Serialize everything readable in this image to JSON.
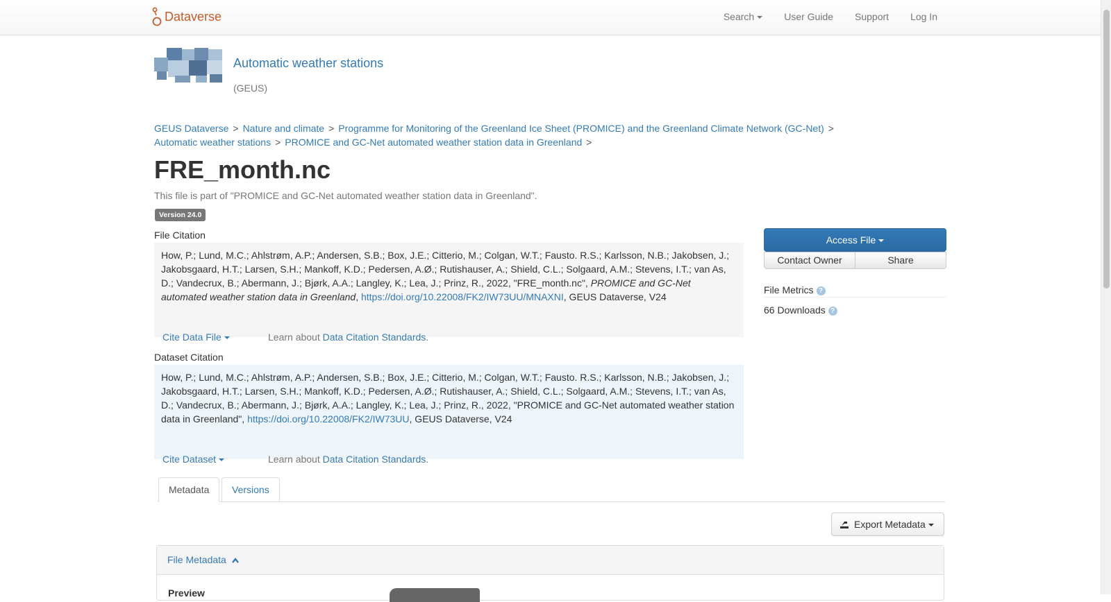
{
  "navbar": {
    "brand": "Dataverse",
    "items": [
      "Search",
      "User Guide",
      "Support",
      "Log In"
    ]
  },
  "dataverse": {
    "title": "Automatic weather stations",
    "affiliation": "(GEUS)"
  },
  "breadcrumb": [
    "GEUS Dataverse",
    "Nature and climate",
    "Programme for Monitoring of the Greenland Ice Sheet (PROMICE) and the Greenland Climate Network (GC-Net)",
    "Automatic weather stations",
    "PROMICE and GC-Net automated weather station data in Greenland"
  ],
  "file": {
    "title": "FRE_month.nc",
    "part_of": "This file is part of \"PROMICE and GC-Net automated weather station data in Greenland\".",
    "version": "Version 24.0"
  },
  "file_citation": {
    "label": "File Citation",
    "authors": "How, P.; Lund, M.C.; Ahlstrøm, A.P.; Andersen, S.B.; Box, J.E.; Citterio, M.; Colgan, W.T.; Fausto. R.S.; Karlsson, N.B.; Jakobsen, J.; Jakobsgaard, H.T.; Larsen, S.H.; Mankoff, K.D.; Pedersen, A.Ø.; Rutishauser, A.; Shield, C.L.; Solgaard, A.M.; Stevens, I.T.; van As, D.; Vandecrux, B.; Abermann, J.; Bjørk, A.A.; Langley, K.; Lea, J.; Prinz, R., 2022, \"FRE_month.nc\", ",
    "dataset_italic": "PROMICE and GC-Net automated weather station data in Greenland",
    "sep": ", ",
    "doi": "https://doi.org/10.22008/FK2/IW73UU/MNAXNI",
    "suffix": ", GEUS Dataverse, V24",
    "cite_button": "Cite Data File",
    "learn_prefix": "Learn about ",
    "learn_link": "Data Citation Standards."
  },
  "dataset_citation": {
    "label": "Dataset Citation",
    "text": "How, P.; Lund, M.C.; Ahlstrøm, A.P.; Andersen, S.B.; Box, J.E.; Citterio, M.; Colgan, W.T.; Fausto. R.S.; Karlsson, N.B.; Jakobsen, J.; Jakobsgaard, H.T.; Larsen, S.H.; Mankoff, K.D.; Pedersen, A.Ø.; Rutishauser, A.; Shield, C.L.; Solgaard, A.M.; Stevens, I.T.; van As, D.; Vandecrux, B.; Abermann, J.; Bjørk, A.A.; Langley, K.; Lea, J.; Prinz, R., 2022, \"PROMICE and GC-Net automated weather station data in Greenland\", ",
    "doi": "https://doi.org/10.22008/FK2/IW73UU",
    "suffix": ", GEUS Dataverse, V24",
    "cite_button": "Cite Dataset",
    "learn_prefix": "Learn about ",
    "learn_link": "Data Citation Standards."
  },
  "actions": {
    "access": "Access File",
    "contact": "Contact Owner",
    "share": "Share"
  },
  "metrics": {
    "title": "File Metrics",
    "downloads": "66 Downloads"
  },
  "tabs": [
    "Metadata",
    "Versions"
  ],
  "export": "Export Metadata",
  "panel": {
    "heading": "File Metadata",
    "preview_label": "Preview"
  },
  "colors": {
    "brand": "#c55b28",
    "link": "#337ab7",
    "primary": "#337ab7"
  }
}
